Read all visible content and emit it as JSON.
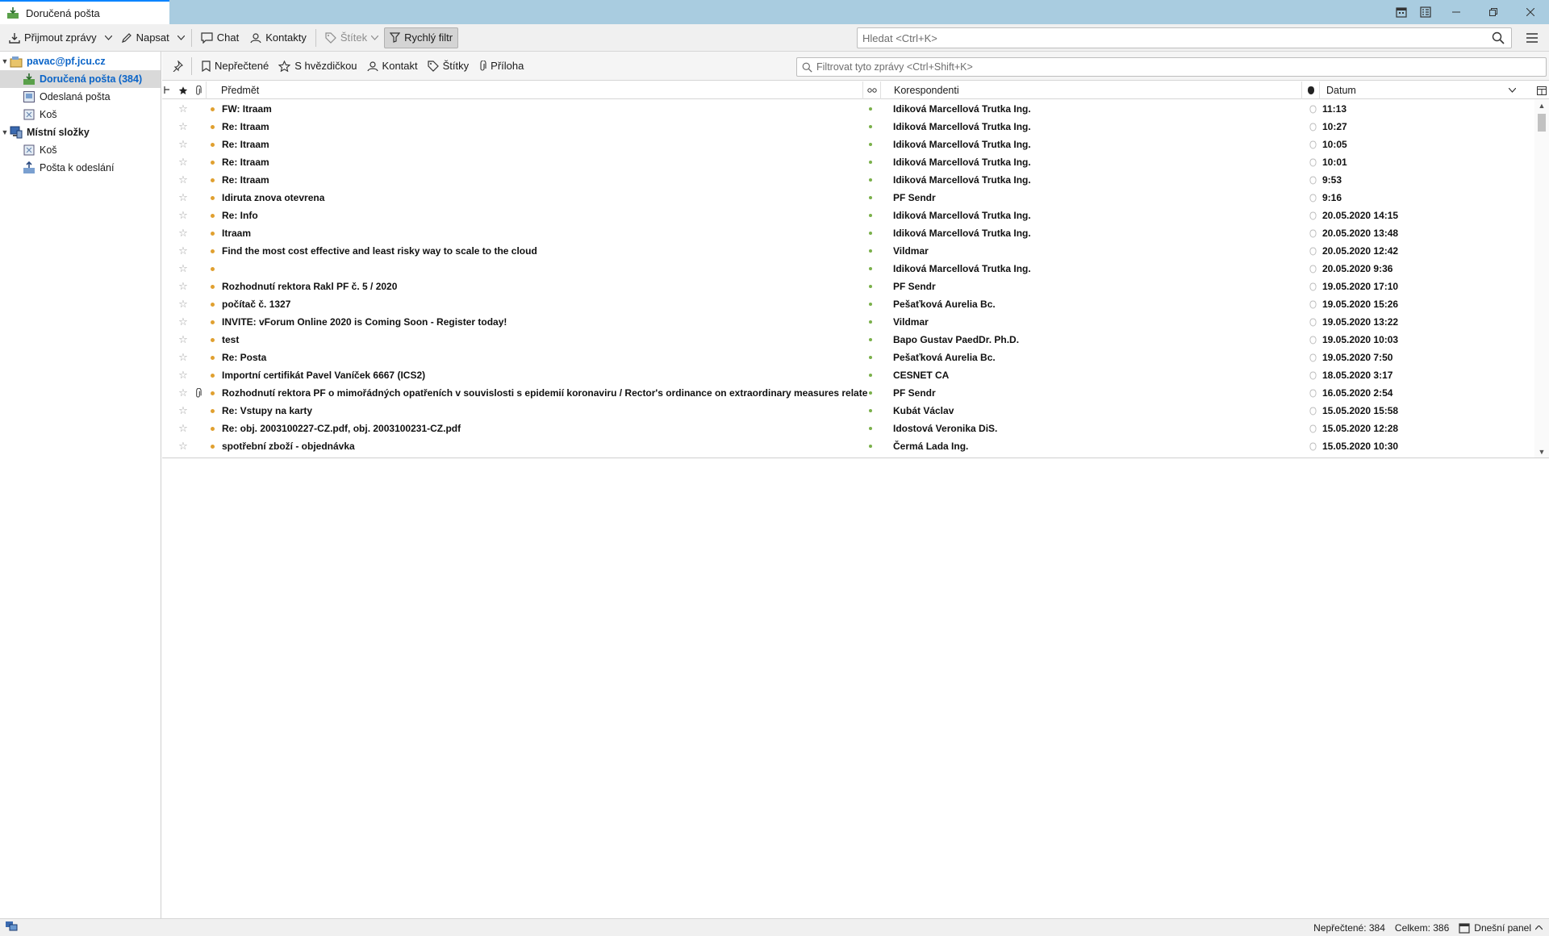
{
  "window": {
    "tab_title": "Doručená pošta",
    "icons": [
      "calendar-icon",
      "tasks-icon"
    ],
    "controls": [
      "minimize",
      "restore",
      "close"
    ]
  },
  "toolbar": {
    "get_messages": "Přijmout zprávy",
    "write": "Napsat",
    "chat": "Chat",
    "contacts": "Kontakty",
    "tag": "Štítek",
    "quick_filter": "Rychlý filtr",
    "search_placeholder": "Hledat <Ctrl+K>"
  },
  "folders": {
    "account": "pavac@pf.jcu.cz",
    "inbox": "Doručená pošta (384)",
    "sent": "Odeslaná pošta",
    "trash": "Koš",
    "local": "Místní složky",
    "local_trash": "Koš",
    "outbox": "Pošta k odeslání"
  },
  "quickfilter": {
    "unread": "Nepřečtené",
    "starred": "S hvězdičkou",
    "contact": "Kontakt",
    "tags": "Štítky",
    "attachment": "Příloha",
    "filter_placeholder": "Filtrovat tyto zprávy <Ctrl+Shift+K>"
  },
  "columns": {
    "subject": "Předmět",
    "correspondents": "Korespondenti",
    "date": "Datum"
  },
  "messages": [
    {
      "subject": "FW: Itraam",
      "from": "Idiková Marcellová Trutka Ing.",
      "date": "11:13",
      "att": false
    },
    {
      "subject": "Re: Itraam",
      "from": "Idiková Marcellová Trutka Ing.",
      "date": "10:27",
      "att": false
    },
    {
      "subject": "Re: Itraam",
      "from": "Idiková Marcellová Trutka Ing.",
      "date": "10:05",
      "att": false
    },
    {
      "subject": "Re: Itraam",
      "from": "Idiková Marcellová Trutka Ing.",
      "date": "10:01",
      "att": false
    },
    {
      "subject": "Re: Itraam",
      "from": "Idiková Marcellová Trutka Ing.",
      "date": "9:53",
      "att": false
    },
    {
      "subject": "Idiruta znova otevrena",
      "from": "PF Sendr",
      "date": "9:16",
      "att": false
    },
    {
      "subject": "Re: Info",
      "from": "Idiková Marcellová Trutka Ing.",
      "date": "20.05.2020 14:15",
      "att": false
    },
    {
      "subject": "Itraam",
      "from": "Idiková Marcellová Trutka Ing.",
      "date": "20.05.2020 13:48",
      "att": false
    },
    {
      "subject": "Find the most cost effective and least risky way to scale to the cloud",
      "from": "Vildmar",
      "date": "20.05.2020 12:42",
      "att": false
    },
    {
      "subject": "",
      "from": "Idiková Marcellová Trutka Ing.",
      "date": "20.05.2020 9:36",
      "att": false
    },
    {
      "subject": "Rozhodnutí rektora Rakl PF č. 5 / 2020",
      "from": "PF Sendr",
      "date": "19.05.2020 17:10",
      "att": false
    },
    {
      "subject": "počítač č. 1327",
      "from": "Pešaťková Aurelia Bc.",
      "date": "19.05.2020 15:26",
      "att": false
    },
    {
      "subject": "INVITE: vForum Online 2020 is Coming Soon - Register today!",
      "from": "Vildmar",
      "date": "19.05.2020 13:22",
      "att": false
    },
    {
      "subject": "test",
      "from": "Bapo Gustav PaedDr. Ph.D.",
      "date": "19.05.2020 10:03",
      "att": false
    },
    {
      "subject": "Re: Posta",
      "from": "Pešaťková Aurelia Bc.",
      "date": "19.05.2020 7:50",
      "att": false
    },
    {
      "subject": "Importní certifikát Pavel Vaníček 6667 (ICS2)",
      "from": "CESNET CA",
      "date": "18.05.2020 3:17",
      "att": false
    },
    {
      "subject": "Rozhodnutí rektora PF o mimořádných opatřeních v souvislosti s epidemií koronaviru / Rector's ordinance on extraordinary measures related",
      "from": "PF Sendr",
      "date": "16.05.2020 2:54",
      "att": true
    },
    {
      "subject": "Re: Vstupy na karty",
      "from": "Kubát Václav",
      "date": "15.05.2020 15:58",
      "att": false
    },
    {
      "subject": "Re: obj. 2003100227-CZ.pdf, obj. 2003100231-CZ.pdf",
      "from": "Idostová Veronika DiS.",
      "date": "15.05.2020 12:28",
      "att": false
    },
    {
      "subject": "spotřební zboží - objednávka",
      "from": "Čermá Lada Ing.",
      "date": "15.05.2020 10:30",
      "att": false
    }
  ],
  "status": {
    "unread": "Nepřečtené: 384",
    "total": "Celkem: 386",
    "today_panel": "Dnešní panel"
  },
  "colors": {
    "titlebar": "#a9cce0",
    "accent": "#0a84ff",
    "unread_dot": "#e0a030",
    "account_blue": "#0a64c8"
  }
}
